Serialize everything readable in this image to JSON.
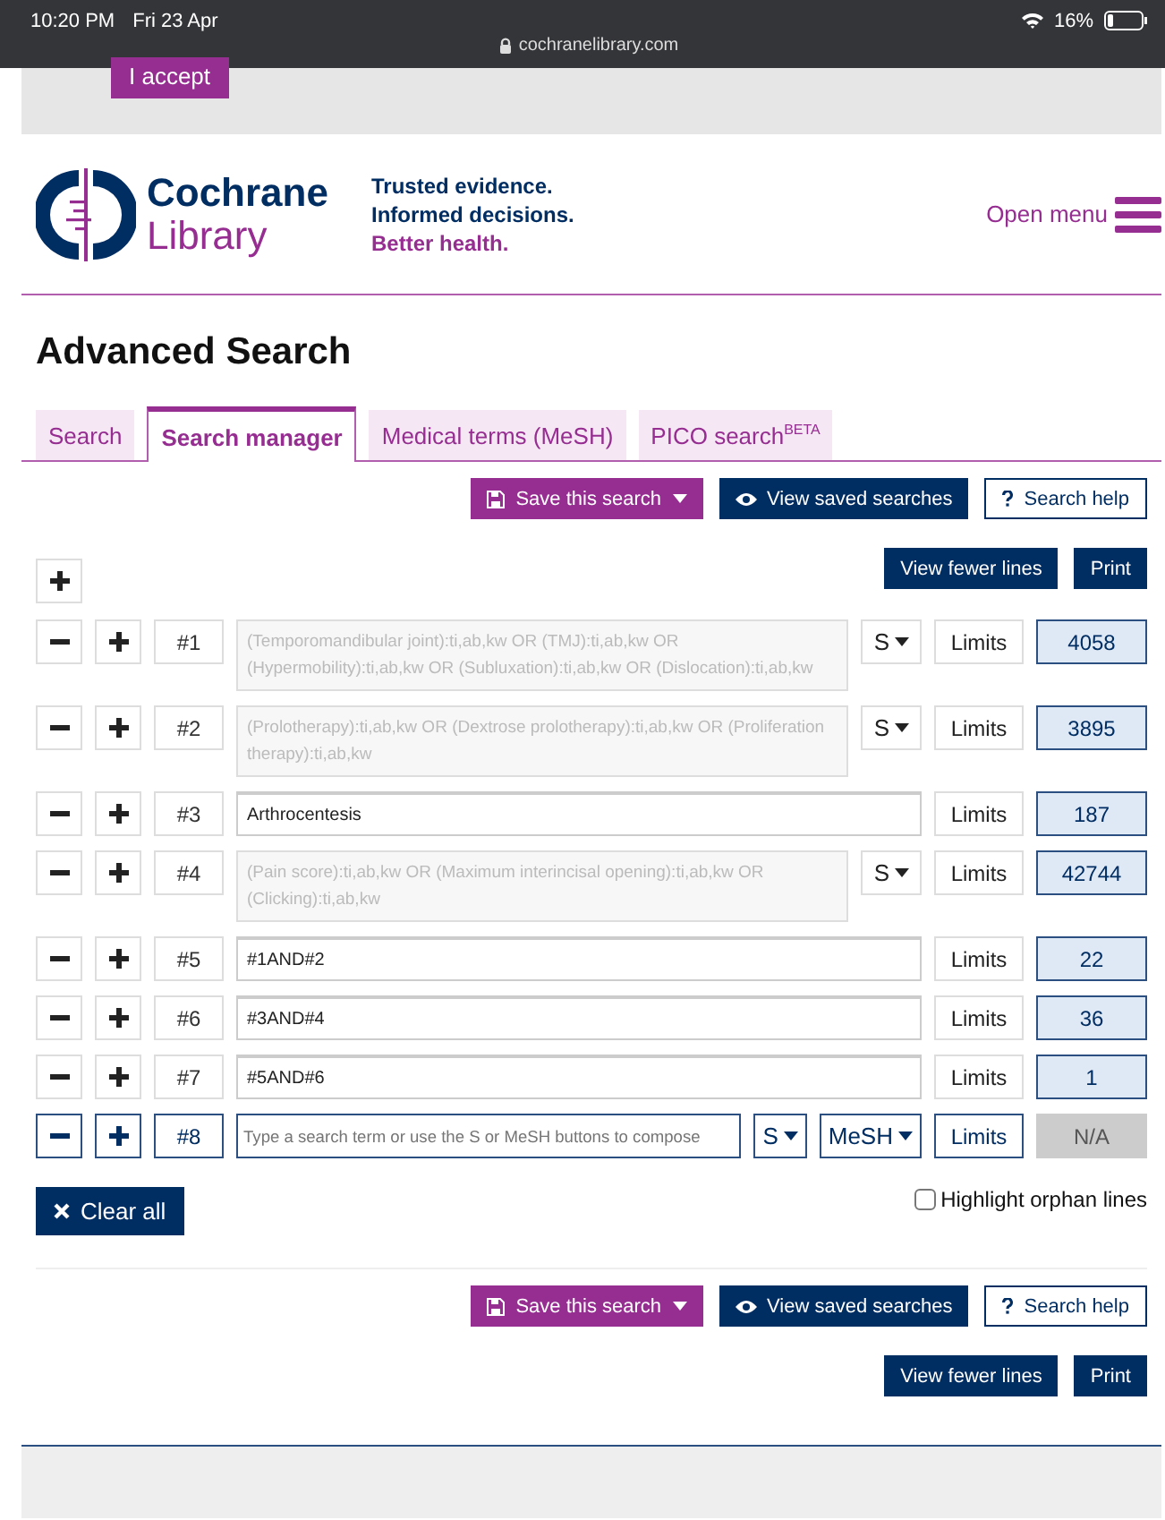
{
  "status_bar": {
    "time": "10:20 PM",
    "date": "Fri 23 Apr",
    "url": "cochranelibrary.com",
    "battery": "16%"
  },
  "cookie_banner": {
    "accept_button": "I accept"
  },
  "header": {
    "logo_top": "Cochrane",
    "logo_bottom": "Library",
    "tagline": [
      "Trusted evidence.",
      "Informed decisions.",
      "Better health."
    ],
    "menu_label": "Open menu"
  },
  "title": "Advanced Search",
  "tabs": [
    {
      "label": "Search",
      "selected": false
    },
    {
      "label": "Search manager",
      "selected": true
    },
    {
      "label": "Medical terms (MeSH)",
      "selected": false
    },
    {
      "label": "PICO search$^{BETA}$",
      "selected": false
    }
  ],
  "toolbar": {
    "save": "Save this search",
    "saved": "View saved searches",
    "help": "Search help",
    "fewer": "View fewer lines",
    "print": "Print"
  },
  "rows": [
    {
      "number": "#1",
      "query": "(Temporomandibular joint):ti,ab,kw OR (TMJ):ti,ab,kw OR (Hypermobility):ti,ab,kw OR (Subluxation):ti,ab,kw OR (Dislocation):ti,ab,kw",
      "disabled": true,
      "s_button": "S",
      "active": false,
      "limits": "Limits",
      "count": "4058"
    },
    {
      "number": "#2",
      "query": "(Prolotherapy):ti,ab,kw OR (Dextrose prolotherapy):ti,ab,kw OR (Proliferation therapy):ti,ab,kw",
      "disabled": true,
      "s_button": "S",
      "active": false,
      "limits": "Limits",
      "count": "3895"
    },
    {
      "number": "#3",
      "query": "Arthrocentesis",
      "disabled": false,
      "active": false,
      "limits": "Limits",
      "count": "187"
    },
    {
      "number": "#4",
      "query": "(Pain score):ti,ab,kw OR (Maximum interincisal opening):ti,ab,kw OR (Clicking):ti,ab,kw",
      "disabled": true,
      "s_button": "S",
      "active": false,
      "limits": "Limits",
      "count": "42744"
    },
    {
      "number": "#5",
      "query": "#1AND#2",
      "disabled": false,
      "active": false,
      "limits": "Limits",
      "count": "22"
    },
    {
      "number": "#6",
      "query": "#3AND#4",
      "disabled": false,
      "active": false,
      "limits": "Limits",
      "count": "36"
    },
    {
      "number": "#7",
      "query": "#5AND#6",
      "disabled": false,
      "active": false,
      "limits": "Limits",
      "count": "1"
    },
    {
      "number": "#8",
      "placeholder": "Type a search term or use the S or MeSH buttons to compose",
      "disabled": false,
      "s_button": "S",
      "mesh_button": "MeSH",
      "active": true,
      "limits": "Limits",
      "count": "N/A"
    }
  ],
  "clear_all": "Clear all",
  "highlight_orphans": {
    "label": "Highlight orphan lines",
    "checked": false
  },
  "bottom_toolbar": {
    "save": "Save this search",
    "saved": "View saved searches",
    "help": "Search help",
    "fewer": "View fewer lines",
    "print": "Print"
  }
}
